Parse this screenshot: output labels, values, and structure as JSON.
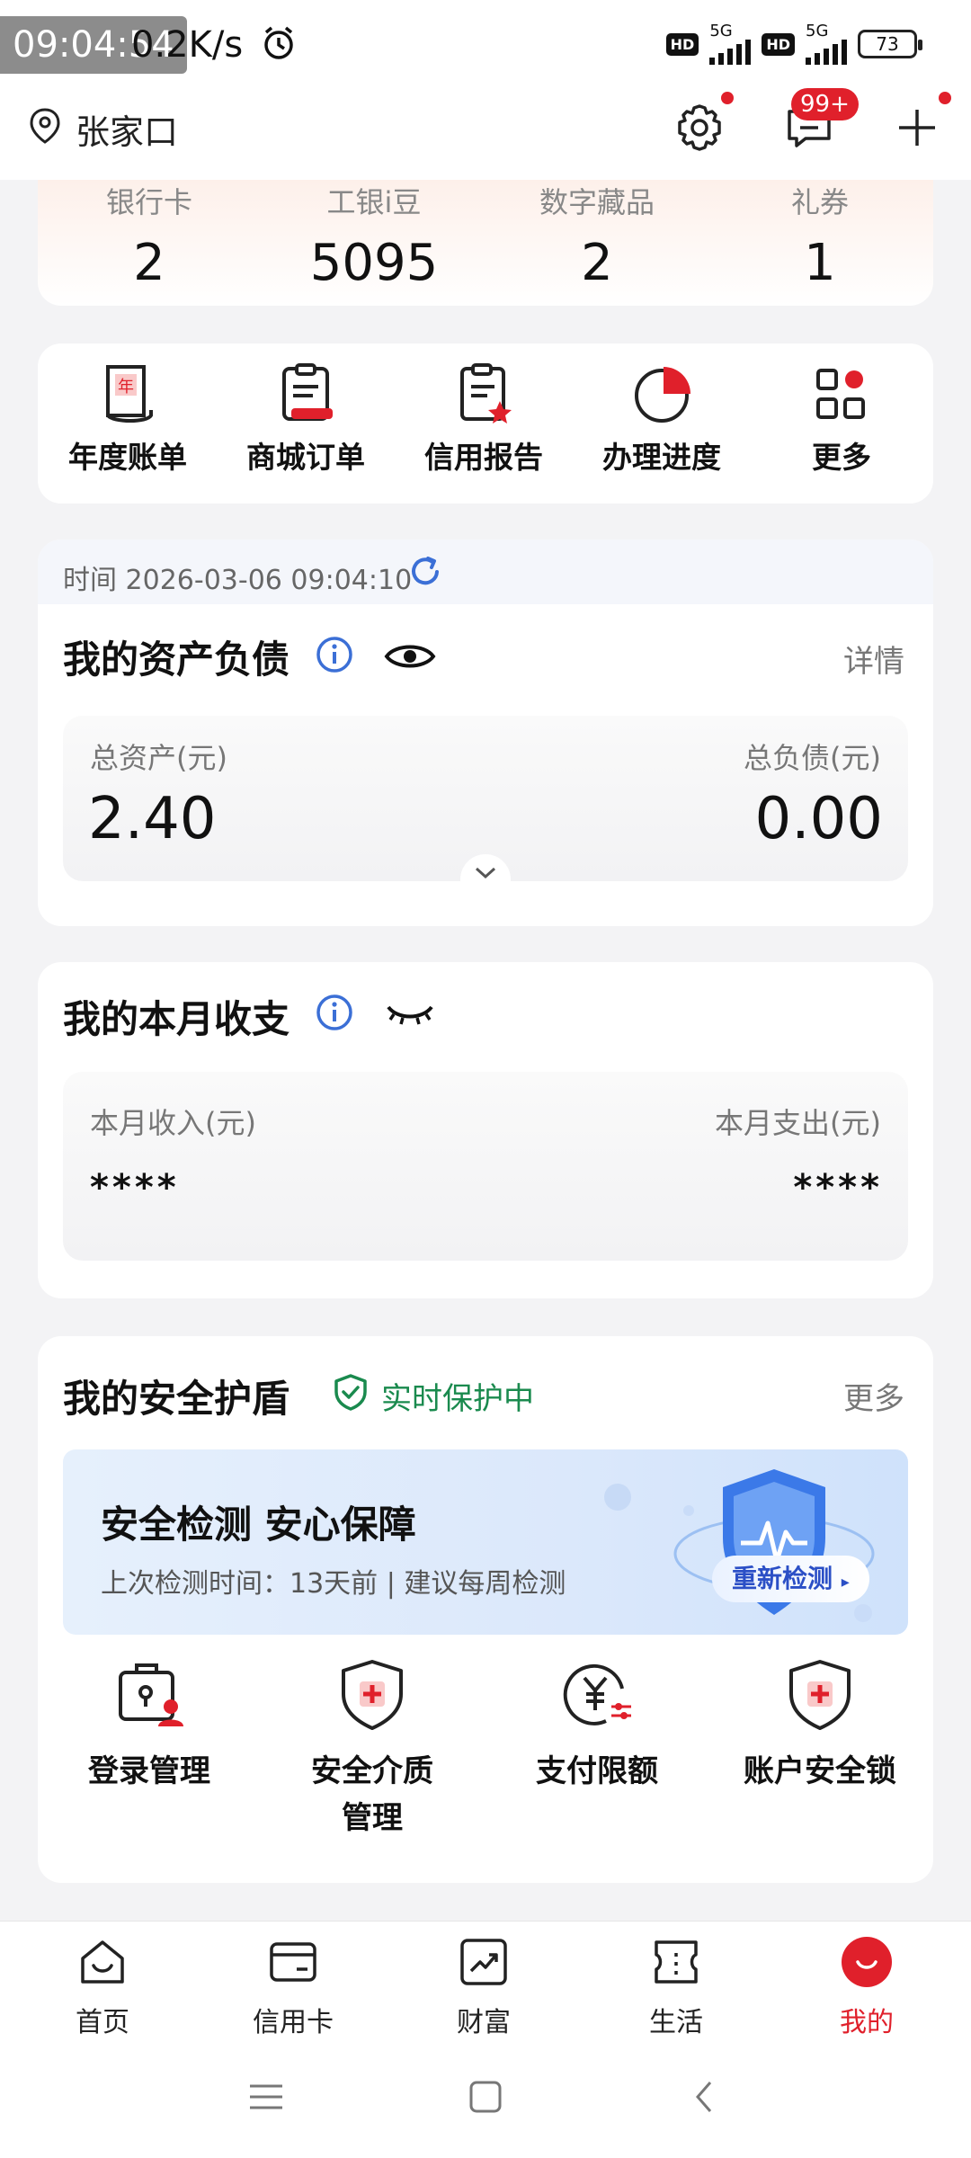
{
  "status_bar": {
    "time": "09:04:54",
    "net_speed": "0.2K/s",
    "hd": "HD",
    "network": "5G",
    "battery": "73"
  },
  "header": {
    "location": "张家口",
    "message_badge": "99+"
  },
  "stats": [
    {
      "label": "银行卡",
      "value": "2"
    },
    {
      "label": "工银i豆",
      "value": "5095"
    },
    {
      "label": "数字藏品",
      "value": "2"
    },
    {
      "label": "礼券",
      "value": "1"
    }
  ],
  "quick_actions": [
    {
      "label": "年度账单",
      "icon": "annual-bill-icon"
    },
    {
      "label": "商城订单",
      "icon": "mall-order-icon"
    },
    {
      "label": "信用报告",
      "icon": "credit-report-icon"
    },
    {
      "label": "办理进度",
      "icon": "progress-icon"
    },
    {
      "label": "更多",
      "icon": "more-grid-icon"
    }
  ],
  "assets": {
    "time": "时间 2026-03-06 09:04:10",
    "title": "我的资产负债",
    "detail_link": "详情",
    "total_assets_label": "总资产(元)",
    "total_assets_value": "2.40",
    "total_debt_label": "总负债(元)",
    "total_debt_value": "0.00"
  },
  "income": {
    "title": "我的本月收支",
    "income_label": "本月收入(元)",
    "income_value": "****",
    "expense_label": "本月支出(元)",
    "expense_value": "****"
  },
  "security": {
    "title": "我的安全护盾",
    "status": "实时保护中",
    "more_link": "更多",
    "banner_title": "安全检测 安心保障",
    "banner_subtitle": "上次检测时间：13天前 | 建议每周检测",
    "recheck_label": "重新检测",
    "items": [
      {
        "label": "登录管理",
        "icon": "login-lock-icon"
      },
      {
        "label": "安全介质管理",
        "icon": "shield-plus-icon"
      },
      {
        "label": "支付限额",
        "icon": "yuan-limit-icon"
      },
      {
        "label": "账户安全锁",
        "icon": "shield-lock-icon"
      }
    ]
  },
  "bottom_nav": [
    {
      "label": "首页",
      "icon": "home-icon",
      "active": false
    },
    {
      "label": "信用卡",
      "icon": "credit-card-icon",
      "active": false
    },
    {
      "label": "财富",
      "icon": "wealth-chart-icon",
      "active": false
    },
    {
      "label": "生活",
      "icon": "ticket-icon",
      "active": false
    },
    {
      "label": "我的",
      "icon": "profile-smile-icon",
      "active": true
    }
  ],
  "colors": {
    "accent_red": "#e0202b",
    "info_blue": "#3b6fd6",
    "safe_green": "#1a8a4e"
  }
}
